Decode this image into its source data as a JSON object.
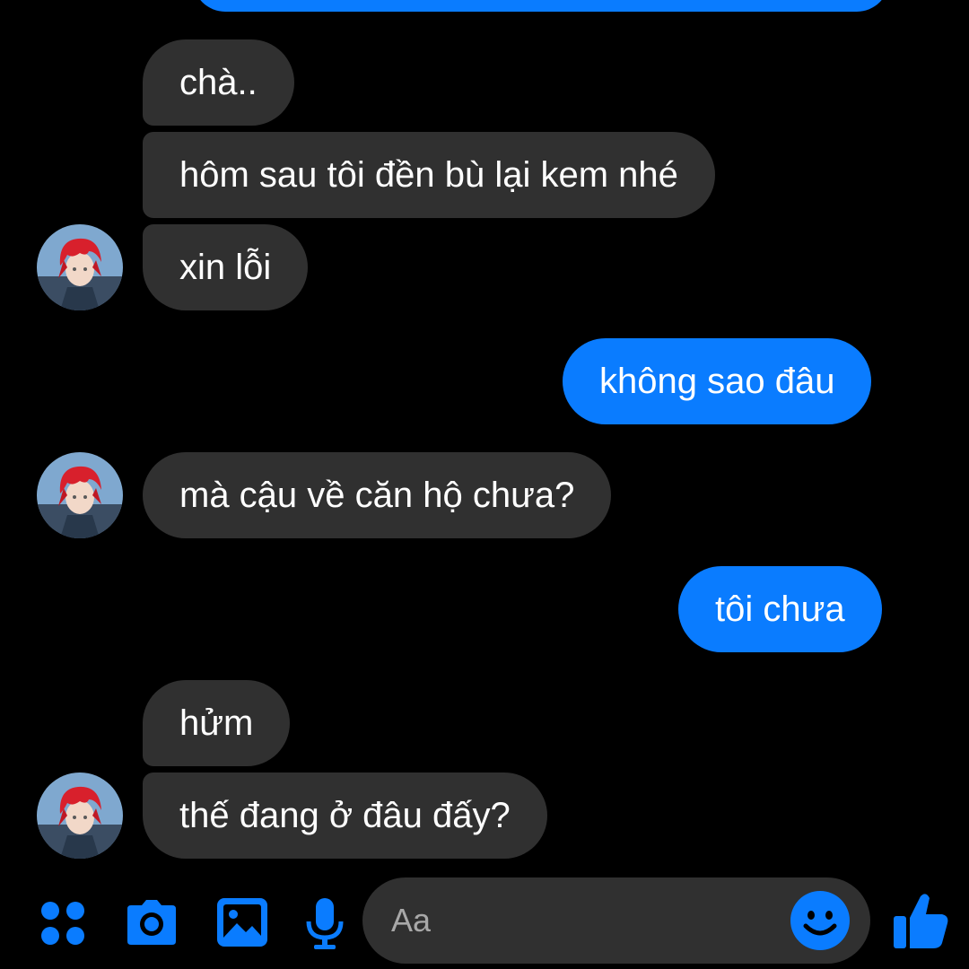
{
  "messages": [
    {
      "sender": "me",
      "text": ""
    },
    {
      "sender": "them",
      "text": "chà.."
    },
    {
      "sender": "them",
      "text": "hôm sau tôi đền bù lại kem nhé"
    },
    {
      "sender": "them",
      "text": "xin lỗi"
    },
    {
      "sender": "me",
      "text": "không sao đâu"
    },
    {
      "sender": "them",
      "text": "mà cậu về căn hộ chưa?"
    },
    {
      "sender": "me",
      "text": "tôi chưa"
    },
    {
      "sender": "them",
      "text": "hửm"
    },
    {
      "sender": "them",
      "text": "thế đang ở đâu đấy?"
    }
  ],
  "composer": {
    "placeholder": "Aa",
    "icons": [
      "grid-menu-icon",
      "camera-icon",
      "image-icon",
      "microphone-icon",
      "emoji-icon",
      "thumbs-up-icon"
    ]
  },
  "colors": {
    "background": "#000000",
    "incoming_bubble": "#303030",
    "outgoing_bubble": "#0a7cff",
    "accent": "#0a7cff"
  }
}
